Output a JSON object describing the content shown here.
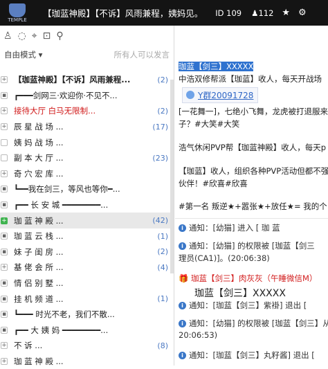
{
  "header": {
    "logo_text": "TEMPLE",
    "title": "【珈蓝神殿】【不诉】风雨兼程，姨妈见。",
    "room_id": "ID 109",
    "user_count": "112",
    "user_icon": "person-icon",
    "star_icon": "star-icon",
    "gear_icon": "gear-icon"
  },
  "left": {
    "toolbar_icons": [
      "user-icon",
      "chat-bubble-icon",
      "location-icon",
      "lock-icon",
      "search-icon"
    ],
    "mode_label": "自由模式",
    "mode_hint": "所有人可以发言",
    "channels": [
      {
        "gut": "+",
        "label": "【珈蓝神殿】【不诉】风雨兼程...",
        "count": "(2)",
        "bold": true
      },
      {
        "gut": "lock",
        "label": "┏━━━剑网三·欢迎你·不见不...",
        "count": ""
      },
      {
        "gut": "+",
        "label": "接待大厅      白马无限制...",
        "count": "(2)",
        "red": true
      },
      {
        "gut": "+",
        "label": "  辰  星  战  场  ...",
        "count": "(17)"
      },
      {
        "gut": "",
        "label": "  姨  妈  战  场  ...",
        "count": ""
      },
      {
        "gut": "",
        "label": "  副  本  大  厅  ...",
        "count": "(23)"
      },
      {
        "gut": "+",
        "label": "  奇  穴  宏  库  ...",
        "count": ""
      },
      {
        "gut": "lock",
        "label": "┗━━我在剑三，等风也等你━...",
        "count": ""
      },
      {
        "gut": "lock",
        "label": "┏━━ 长 安 城 ━━━━━━━━...",
        "count": ""
      },
      {
        "gut": "green",
        "label": "   珈  蓝  神  殿  ...",
        "count": "(42)",
        "sel": true
      },
      {
        "gut": "lock",
        "label": "   珈  蓝  云  栈  ...",
        "count": "(1)"
      },
      {
        "gut": "lock",
        "label": "   妹  子  闺  房  ...",
        "count": "(2)"
      },
      {
        "gut": "+",
        "label": "   基  佬  会  所  ...",
        "count": "(4)"
      },
      {
        "gut": "lock",
        "label": "   情  侣  别  墅  ...",
        "count": ""
      },
      {
        "gut": "lock",
        "label": "   挂  机  频  道  ...",
        "count": "(1)"
      },
      {
        "gut": "lock",
        "label": "┗━━━ 时光不老，我们不散...",
        "count": ""
      },
      {
        "gut": "lock",
        "label": "┏━━ 大 姨 妈 ━━━━━━━━...",
        "count": ""
      },
      {
        "gut": "+",
        "label": "      不        诉  ...",
        "count": "(8)"
      },
      {
        "gut": "+",
        "label": "   珈  蓝  神  殿  ...",
        "count": ""
      }
    ]
  },
  "chat": {
    "m1": "珈蓝【剑三】XXXXX",
    "m2": "中浩双修帮派【珈蓝】收人，每天开战场",
    "qq": "Y群20091728",
    "m3": "[一花舞一]，七绝小飞舞，龙虎被打退服来",
    "m4": "子？#大笑#大笑",
    "m5": "浩气休闲PVP帮【珈蓝神殿】收人，每天p",
    "m6": "【珈蓝】收人，组织各种PVP活动但都不强",
    "m7": "伙伴！#欣喜#欣喜",
    "m8": "#第一名 叛逆★+嚣张★+放任★= 我的个",
    "n1": "通知：[幼猫] 进入 [        珈   蓝",
    "n2": "通知：[幼猫] 的权限被 [珈蓝【剑三",
    "n2b": "理员(CA1)]。(20:06:38)",
    "gift": "珈蓝【剑三】肉灰灰（午睡微信M）",
    "big": "珈蓝【剑三】XXXXX",
    "n3": "通知：[珈蓝【剑三】紫褂] 退出 [",
    "n4": "通知：[幼猫] 的权限被 [珈蓝【剑三】从",
    "n4b": "20:06:53)",
    "n5": "通知：[珈蓝【剑三】丸籽酱] 退出 ["
  }
}
